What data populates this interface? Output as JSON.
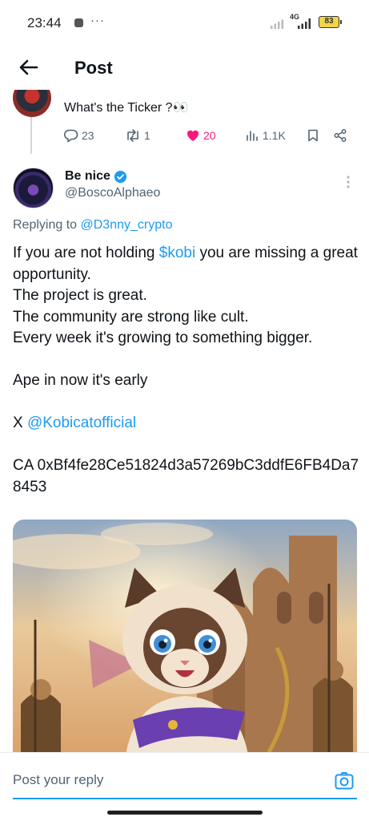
{
  "status_bar": {
    "time": "23:44",
    "dots": "···",
    "network": "4G",
    "battery": "83"
  },
  "header": {
    "title": "Post",
    "back_icon": "arrow-left-icon"
  },
  "previous_post": {
    "text": "What's the Ticker ?👀",
    "replies": "23",
    "reposts": "1",
    "likes": "20",
    "views": "1.1K"
  },
  "post": {
    "name": "Be nice",
    "handle": "@BoscoAlphaeo",
    "replying_prefix": "Replying to ",
    "replying_to": "@D3nny_crypto",
    "line1_pre": "If you are not holding ",
    "cashtag": "$kobi",
    "line1_post": " you are missing a great opportunity.",
    "line2": "The project is great.",
    "line3": "The community are strong like cult.",
    "line4": "Every week it's growing to something bigger.",
    "line5": "Ape in now it's early",
    "x_prefix": "X ",
    "x_mention": "@Kobicatofficial",
    "ca_line": "CA 0xBf4fe28Ce51824d3a57269bC3ddfE6FB4Da78453"
  },
  "reply_bar": {
    "placeholder": "Post your reply"
  },
  "colors": {
    "accent": "#1d9bf0",
    "like": "#f91880",
    "muted": "#536471",
    "text": "#0f1419"
  }
}
